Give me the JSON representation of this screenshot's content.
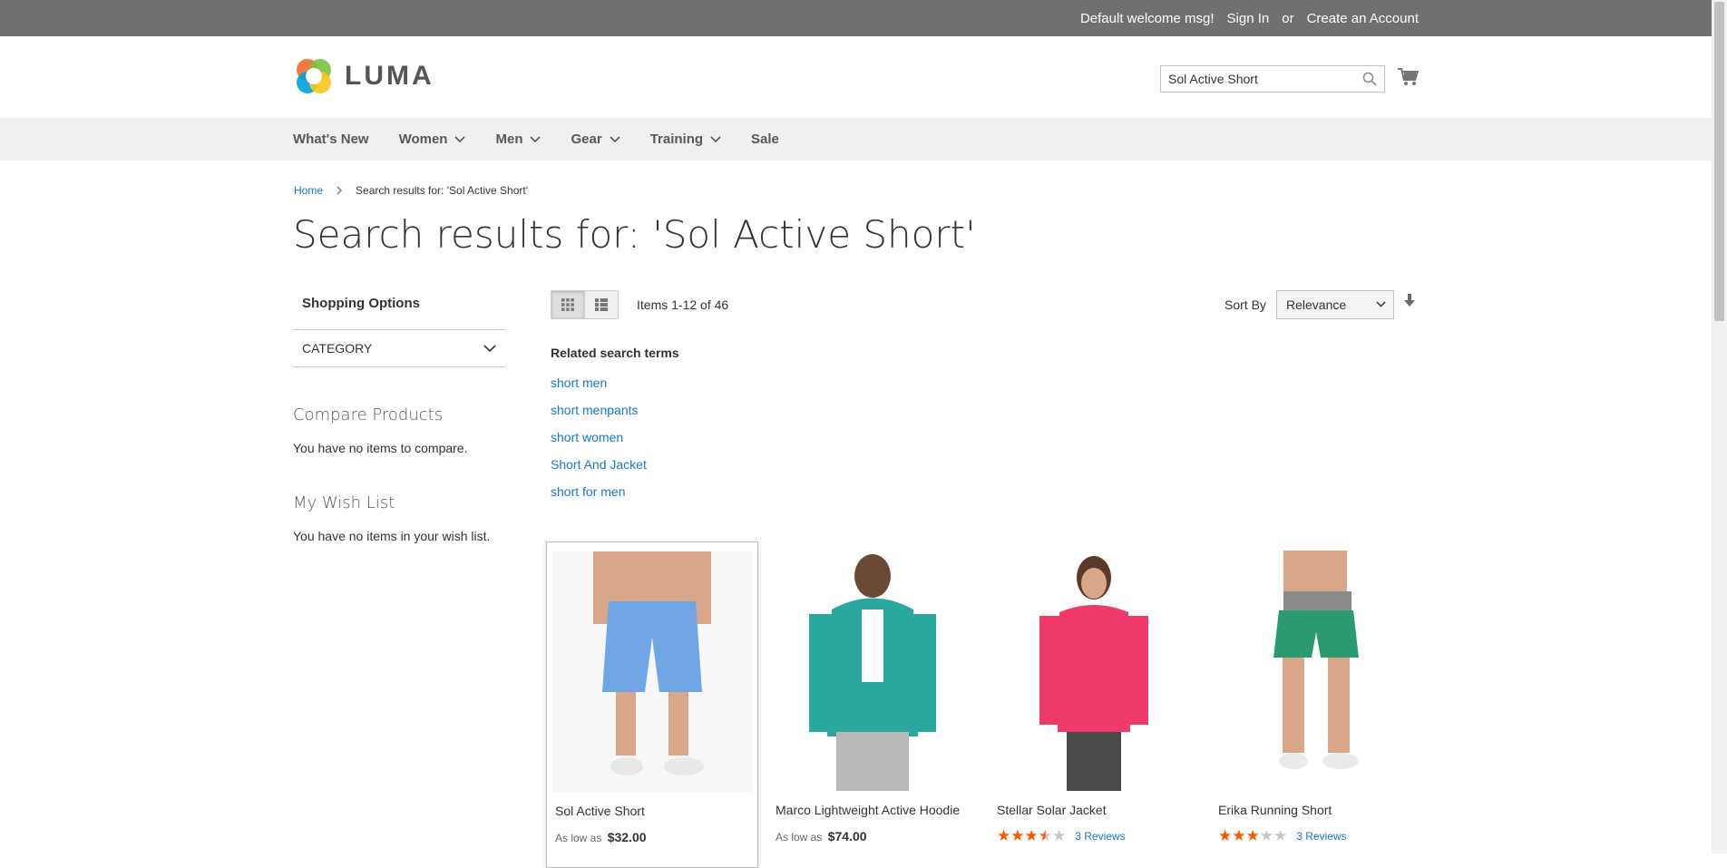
{
  "top_bar": {
    "welcome": "Default welcome msg!",
    "sign_in": "Sign In",
    "or": "or",
    "create_account": "Create an Account"
  },
  "logo": {
    "text": "LUMA"
  },
  "search": {
    "value": "Sol Active Short",
    "icon": "search-icon"
  },
  "nav": {
    "items": [
      {
        "label": "What's New"
      },
      {
        "label": "Women"
      },
      {
        "label": "Men"
      },
      {
        "label": "Gear"
      },
      {
        "label": "Training"
      },
      {
        "label": "Sale"
      }
    ]
  },
  "breadcrumb": {
    "home": "Home",
    "current": "Search results for: 'Sol Active Short'"
  },
  "page_title": "Search results for: 'Sol Active Short'",
  "sidebar": {
    "shopping_options": "Shopping Options",
    "category_filter": "CATEGORY",
    "compare_title": "Compare Products",
    "compare_text": "You have no items to compare.",
    "wishlist_title": "My Wish List",
    "wishlist_text": "You have no items in your wish list."
  },
  "toolbar": {
    "amount": "Items 1-12 of 46",
    "sort_label": "Sort By",
    "sort_value": "Relevance"
  },
  "related": {
    "title": "Related search terms",
    "terms": [
      "short men",
      "short menpants",
      "short women",
      "Short And Jacket",
      "short for men"
    ]
  },
  "products": [
    {
      "name": "Sol Active Short",
      "price_prefix": "As low as",
      "price": "$32.00"
    },
    {
      "name": "Marco Lightweight Active Hoodie",
      "price_prefix": "As low as",
      "price": "$74.00"
    },
    {
      "name": "Stellar Solar Jacket",
      "rating_fraction": 0.7,
      "reviews": "3 Reviews"
    },
    {
      "name": "Erika Running Short",
      "rating_fraction": 0.6,
      "reviews": "3 Reviews"
    }
  ],
  "colors": {
    "link": "#1979c3",
    "star": "#ff5501",
    "topbar": "#6e716e"
  }
}
